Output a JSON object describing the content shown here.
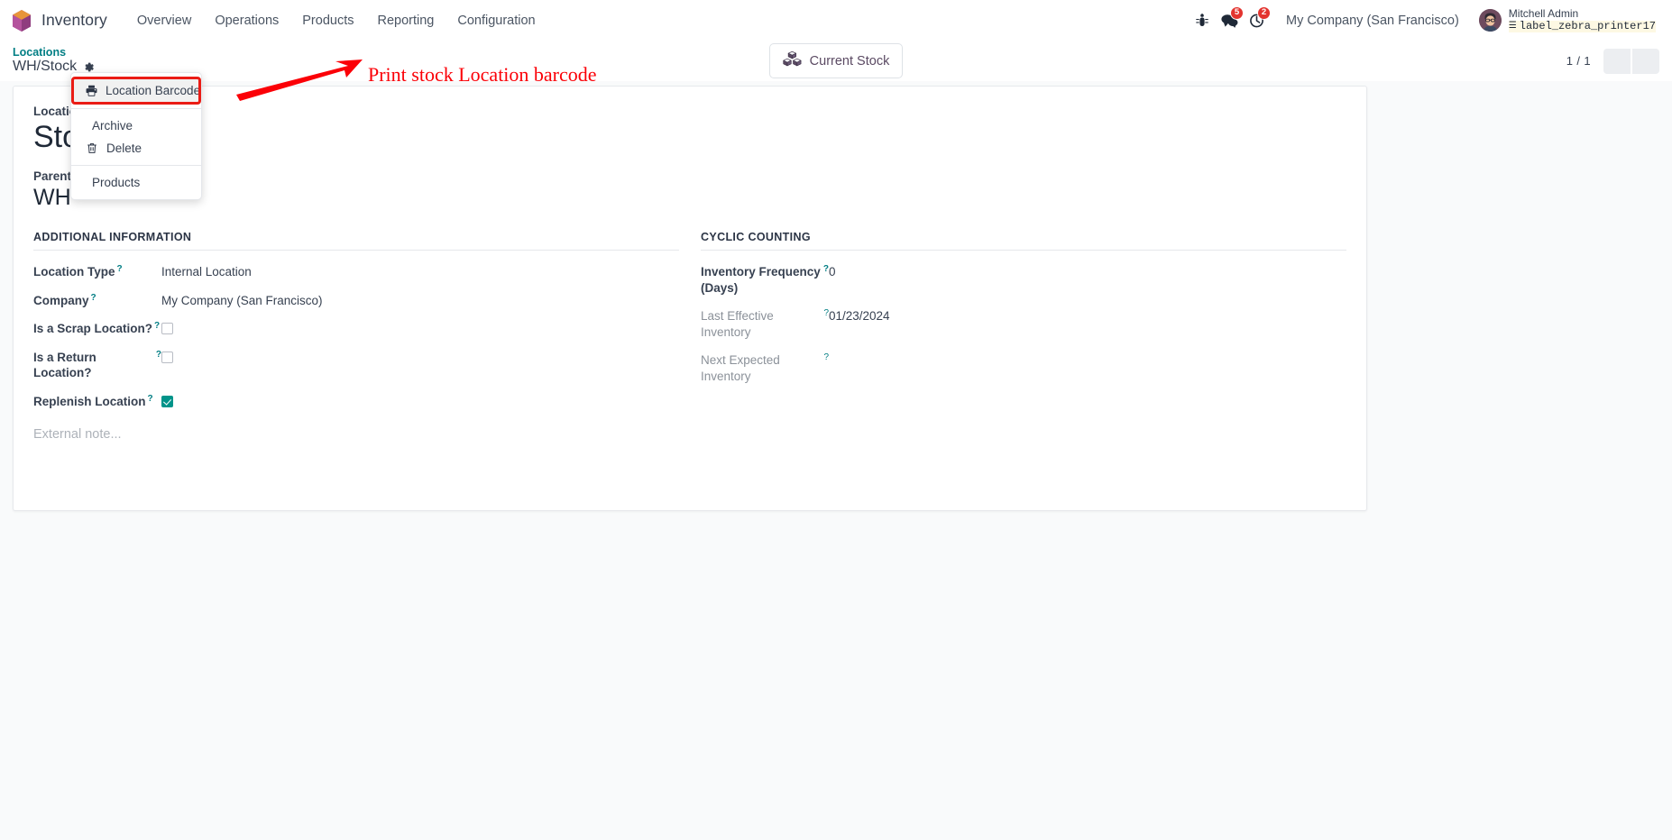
{
  "navbar": {
    "brand": "Inventory",
    "menus": [
      "Overview",
      "Operations",
      "Products",
      "Reporting",
      "Configuration"
    ],
    "icons": {
      "debug": "bug-icon",
      "messages": "chat-icon",
      "activities": "clock-icon"
    },
    "badges": {
      "messages": "5",
      "activities": "2"
    },
    "company": "My Company (San Francisco)",
    "user": {
      "name": "Mitchell Admin",
      "database": "label_zebra_printer17"
    }
  },
  "control_panel": {
    "breadcrumb_parent": "Locations",
    "breadcrumb_current": "WH/Stock",
    "gear_icon": "gear-icon",
    "stat_button": {
      "label": "Current Stock",
      "icon": "boxes-icon"
    },
    "pager": "1 / 1"
  },
  "dropdown": {
    "items": [
      {
        "label": "Location Barcode",
        "icon": "printer-icon",
        "highlighted": true
      },
      {
        "label": "Archive",
        "icon": "",
        "highlighted": false
      },
      {
        "label": "Delete",
        "icon": "trash-icon",
        "highlighted": false
      },
      {
        "label": "Products",
        "icon": "",
        "highlighted": false
      }
    ]
  },
  "annotation": {
    "text": "Print stock Location barcode",
    "color": "#fb0007"
  },
  "form": {
    "title_label": "Location Name",
    "title_value": "Stock",
    "subtitle_label": "Parent Location",
    "subtitle_value": "WH",
    "left_group": {
      "title": "Additional Information",
      "rows": [
        {
          "label": "Location Type",
          "tip": "?",
          "value": "Internal Location",
          "type": "text"
        },
        {
          "label": "Company",
          "tip": "?",
          "value": "My Company (San Francisco)",
          "type": "text"
        },
        {
          "label": "Is a Scrap Location?",
          "tip": "?",
          "value": "",
          "type": "checkbox",
          "checked": false
        },
        {
          "label": "Is a Return Location?",
          "tip": "?",
          "value": "",
          "type": "checkbox",
          "checked": false
        },
        {
          "label": "Replenish Location",
          "tip": "?",
          "value": "",
          "type": "checkbox",
          "checked": true
        }
      ],
      "note_placeholder": "External note..."
    },
    "right_group": {
      "title": "Cyclic Counting",
      "rows": [
        {
          "label": "Inventory Frequency (Days)",
          "tip": "?",
          "value": "0",
          "muted": false
        },
        {
          "label": "Last Effective Inventory",
          "tip": "?",
          "value": "01/23/2024",
          "muted": true
        },
        {
          "label": "Next Expected Inventory",
          "tip": "?",
          "value": "",
          "muted": true
        }
      ]
    }
  },
  "colors": {
    "brand_teal": "#017e84",
    "checkbox_teal": "#00948a",
    "badge_red": "#e3342f",
    "annotation_red": "#fb0007",
    "page_bg": "#f9fafb"
  }
}
